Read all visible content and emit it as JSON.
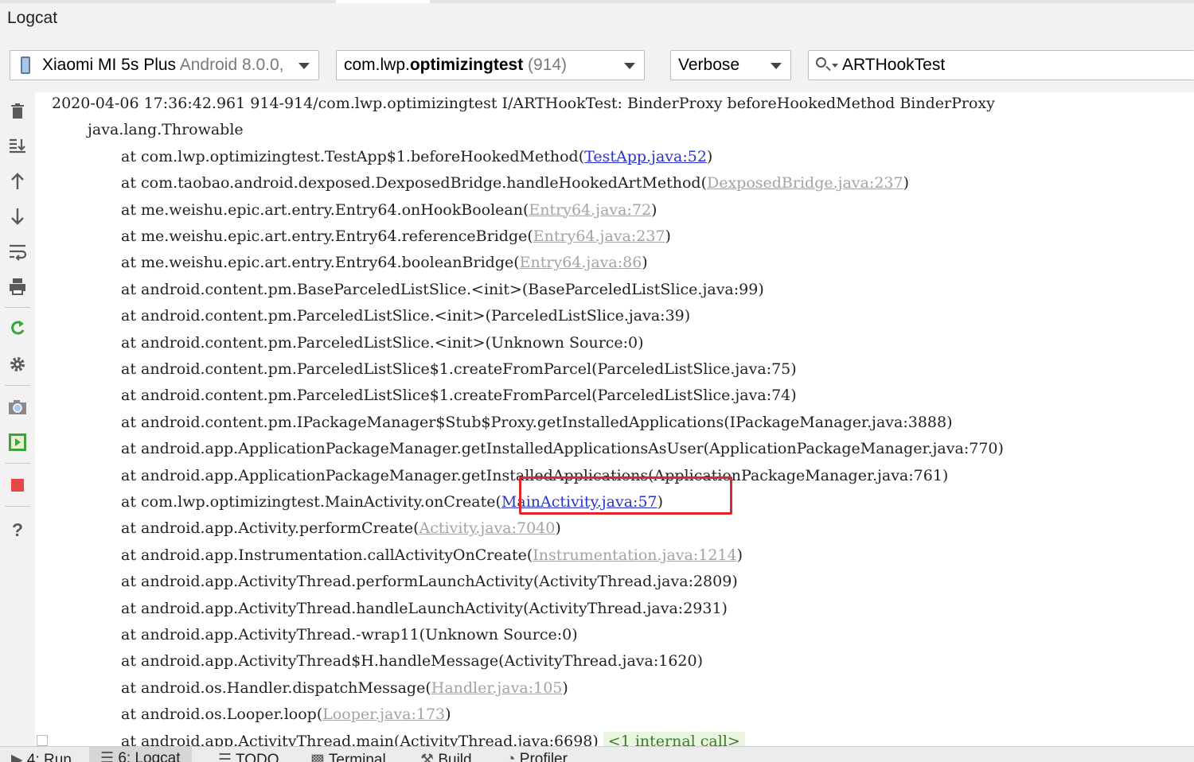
{
  "window": {
    "title": "Logcat"
  },
  "toolbar": {
    "device": {
      "name": "Xiaomi MI 5s Plus",
      "detail": "Android 8.0.0,"
    },
    "process": {
      "prefix": "com.lwp.",
      "name": "optimizingtest",
      "pid": "(914)"
    },
    "level": "Verbose",
    "search": {
      "value": "ARTHookTest"
    }
  },
  "log": {
    "lines": [
      {
        "indent": 0,
        "text": "2020-04-06 17:36:42.961 914-914/com.lwp.optimizingtest I/ARTHookTest: BinderProxy beforeHookedMethod BinderProxy"
      },
      {
        "indent": 1,
        "text": "java.lang.Throwable"
      },
      {
        "indent": 2,
        "text": "at com.lwp.optimizingtest.TestApp$1.beforeHookedMethod(",
        "link": "TestApp.java:52",
        "linkStyle": "active",
        "after": ")"
      },
      {
        "indent": 2,
        "text": "at com.taobao.android.dexposed.DexposedBridge.handleHookedArtMethod(",
        "link": "DexposedBridge.java:237",
        "linkStyle": "gray",
        "after": ")"
      },
      {
        "indent": 2,
        "text": "at me.weishu.epic.art.entry.Entry64.onHookBoolean(",
        "link": "Entry64.java:72",
        "linkStyle": "gray",
        "after": ")"
      },
      {
        "indent": 2,
        "text": "at me.weishu.epic.art.entry.Entry64.referenceBridge(",
        "link": "Entry64.java:237",
        "linkStyle": "gray",
        "after": ")"
      },
      {
        "indent": 2,
        "text": "at me.weishu.epic.art.entry.Entry64.booleanBridge(",
        "link": "Entry64.java:86",
        "linkStyle": "gray",
        "after": ")"
      },
      {
        "indent": 2,
        "text": "at android.content.pm.BaseParceledListSlice.<init>(BaseParceledListSlice.java:99)"
      },
      {
        "indent": 2,
        "text": "at android.content.pm.ParceledListSlice.<init>(ParceledListSlice.java:39)"
      },
      {
        "indent": 2,
        "text": "at android.content.pm.ParceledListSlice.<init>(Unknown Source:0)"
      },
      {
        "indent": 2,
        "text": "at android.content.pm.ParceledListSlice$1.createFromParcel(ParceledListSlice.java:75)"
      },
      {
        "indent": 2,
        "text": "at android.content.pm.ParceledListSlice$1.createFromParcel(ParceledListSlice.java:74)"
      },
      {
        "indent": 2,
        "text": "at android.content.pm.IPackageManager$Stub$Proxy.getInstalledApplications(IPackageManager.java:3888)"
      },
      {
        "indent": 2,
        "text": "at android.app.ApplicationPackageManager.getInstalledApplicationsAsUser(ApplicationPackageManager.java:770)"
      },
      {
        "indent": 2,
        "text": "at android.app.ApplicationPackageManager.getInstalledApplications(ApplicationPackageManager.java:761)"
      },
      {
        "indent": 2,
        "text": "at com.lwp.optimizingtest.MainActivity.onCreate(",
        "link": "MainActivity.java:57",
        "linkStyle": "active",
        "after": ")"
      },
      {
        "indent": 2,
        "text": "at android.app.Activity.performCreate(",
        "link": "Activity.java:7040",
        "linkStyle": "gray",
        "after": ")"
      },
      {
        "indent": 2,
        "text": "at android.app.Instrumentation.callActivityOnCreate(",
        "link": "Instrumentation.java:1214",
        "linkStyle": "gray",
        "after": ")"
      },
      {
        "indent": 2,
        "text": "at android.app.ActivityThread.performLaunchActivity(ActivityThread.java:2809)"
      },
      {
        "indent": 2,
        "text": "at android.app.ActivityThread.handleLaunchActivity(ActivityThread.java:2931)"
      },
      {
        "indent": 2,
        "text": "at android.app.ActivityThread.-wrap11(Unknown Source:0)"
      },
      {
        "indent": 2,
        "text": "at android.app.ActivityThread$H.handleMessage(ActivityThread.java:1620)"
      },
      {
        "indent": 2,
        "text": "at android.os.Handler.dispatchMessage(",
        "link": "Handler.java:105",
        "linkStyle": "gray",
        "after": ")"
      },
      {
        "indent": 2,
        "text": "at android.os.Looper.loop(",
        "link": "Looper.java:173",
        "linkStyle": "gray",
        "after": ")"
      },
      {
        "indent": 2,
        "text": "at android.app.ActivityThread.main(ActivityThread.java:6698)",
        "badge": "<1 internal call>"
      }
    ]
  },
  "sidebar": {
    "icons": [
      "trash-icon",
      "scroll-to-end-icon",
      "up-arrow-icon",
      "down-arrow-icon",
      "soft-wrap-icon",
      "print-icon",
      "restart-icon",
      "settings-icon",
      "screenshot-icon",
      "screen-record-icon",
      "stop-icon",
      "help-icon"
    ]
  },
  "bottom_tabs": [
    {
      "label": "4: Run"
    },
    {
      "label": "6: Logcat",
      "active": true
    },
    {
      "label": "TODO"
    },
    {
      "label": "Terminal"
    },
    {
      "label": "Build"
    },
    {
      "label": "Profiler"
    }
  ],
  "colors": {
    "highlight": "#e3262b",
    "link": "#2a34c6",
    "link_muted": "#a3a3a3"
  }
}
